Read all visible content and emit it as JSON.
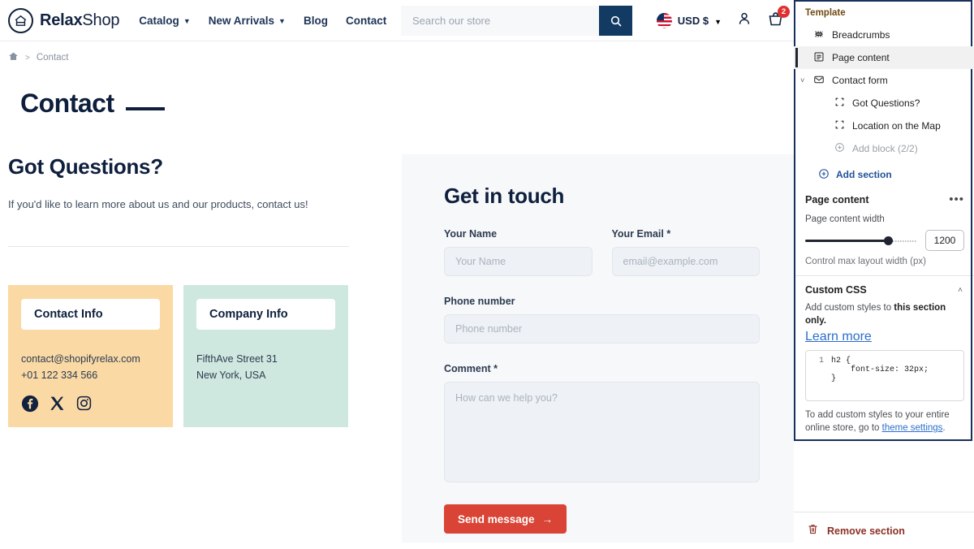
{
  "storefront": {
    "logo": {
      "bold": "Relax",
      "rest": "Shop",
      "icon": "home-circle-icon"
    },
    "nav": [
      {
        "label": "Catalog",
        "has_caret": true
      },
      {
        "label": "New Arrivals",
        "has_caret": true
      },
      {
        "label": "Blog",
        "has_caret": false
      },
      {
        "label": "Contact",
        "has_caret": false
      }
    ],
    "search": {
      "placeholder": "Search our store",
      "value": ""
    },
    "currency": {
      "label": "USD $",
      "flag": "us-flag-icon"
    },
    "cart": {
      "badge": "2"
    },
    "breadcrumb": {
      "home": "home-icon",
      "separator": ">",
      "current": "Contact"
    },
    "page_title": "Contact"
  },
  "left_column": {
    "heading": "Got Questions?",
    "description": "If you'd like to learn more about us and our products, contact us!",
    "contact_card": {
      "title": "Contact Info",
      "email": "contact@shopifyrelax.com",
      "phone": "+01 122 334 566",
      "socials": [
        "facebook-icon",
        "x-twitter-icon",
        "instagram-icon"
      ],
      "bg": "#fad9a5"
    },
    "company_card": {
      "title": "Company Info",
      "address_line1": "FifthAve Street 31",
      "address_line2": "New York, USA",
      "bg": "#cfe8df"
    }
  },
  "form": {
    "heading": "Get in touch",
    "fields": [
      {
        "label": "Your Name",
        "placeholder": "Your Name",
        "value": ""
      },
      {
        "label": "Your Email *",
        "placeholder": "email@example.com",
        "value": ""
      },
      {
        "label": "Phone number",
        "placeholder": "Phone number",
        "value": ""
      },
      {
        "label": "Comment *",
        "placeholder": "How can we help you?",
        "value": ""
      }
    ],
    "submit": {
      "label": "Send message",
      "arrow": "→",
      "color": "#d94436"
    }
  },
  "sidebar": {
    "group_title": "Template",
    "tree": [
      {
        "label": "Breadcrumbs",
        "icon": "breadcrumbs-icon",
        "level": 1,
        "selected": false,
        "muted": false
      },
      {
        "label": "Page content",
        "icon": "page-content-icon",
        "level": 1,
        "selected": true,
        "muted": false
      },
      {
        "label": "Contact form",
        "icon": "envelope-icon",
        "level": 1,
        "selected": false,
        "muted": false,
        "chevron": "˅"
      },
      {
        "label": "Got Questions?",
        "icon": "block-icon",
        "level": 2,
        "selected": false,
        "muted": false
      },
      {
        "label": "Location on the Map",
        "icon": "block-icon",
        "level": 2,
        "selected": false,
        "muted": false
      },
      {
        "label": "Add block (2/2)",
        "icon": "plus-circle-icon",
        "level": 2,
        "selected": false,
        "muted": true
      }
    ],
    "add_section": {
      "label": "Add section",
      "icon": "plus-circle-icon"
    },
    "section": {
      "title": "Page content",
      "more_icon": "ellipsis-icon",
      "width_label": "Page content width",
      "width_value": "1200",
      "width_help": "Control max layout width (px)",
      "slider_percent": 74
    },
    "custom_css": {
      "title": "Custom CSS",
      "collapse_icon": "chevron-up-icon",
      "desc_pre": "Add custom styles to ",
      "desc_bold": "this section only.",
      "learn_more": "Learn more",
      "code_line_number": "1",
      "code": "h2 {\n    font-size: 32px;\n}",
      "footer_pre": "To add custom styles to your entire online store, go to ",
      "footer_link": "theme settings",
      "footer_post": "."
    },
    "remove": {
      "label": "Remove section",
      "icon": "trash-icon"
    }
  }
}
